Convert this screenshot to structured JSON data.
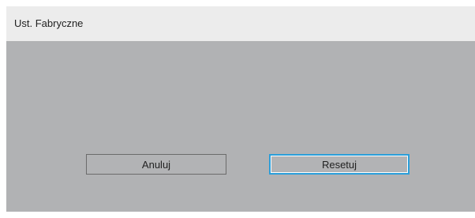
{
  "dialog": {
    "title": "Ust. Fabryczne",
    "cancel_label": "Anuluj",
    "reset_label": "Resetuj",
    "focused_button": "reset",
    "colors": {
      "panel": "#b1b2b4",
      "title_bar": "#ececec",
      "focus": "#2b9ed9"
    }
  }
}
